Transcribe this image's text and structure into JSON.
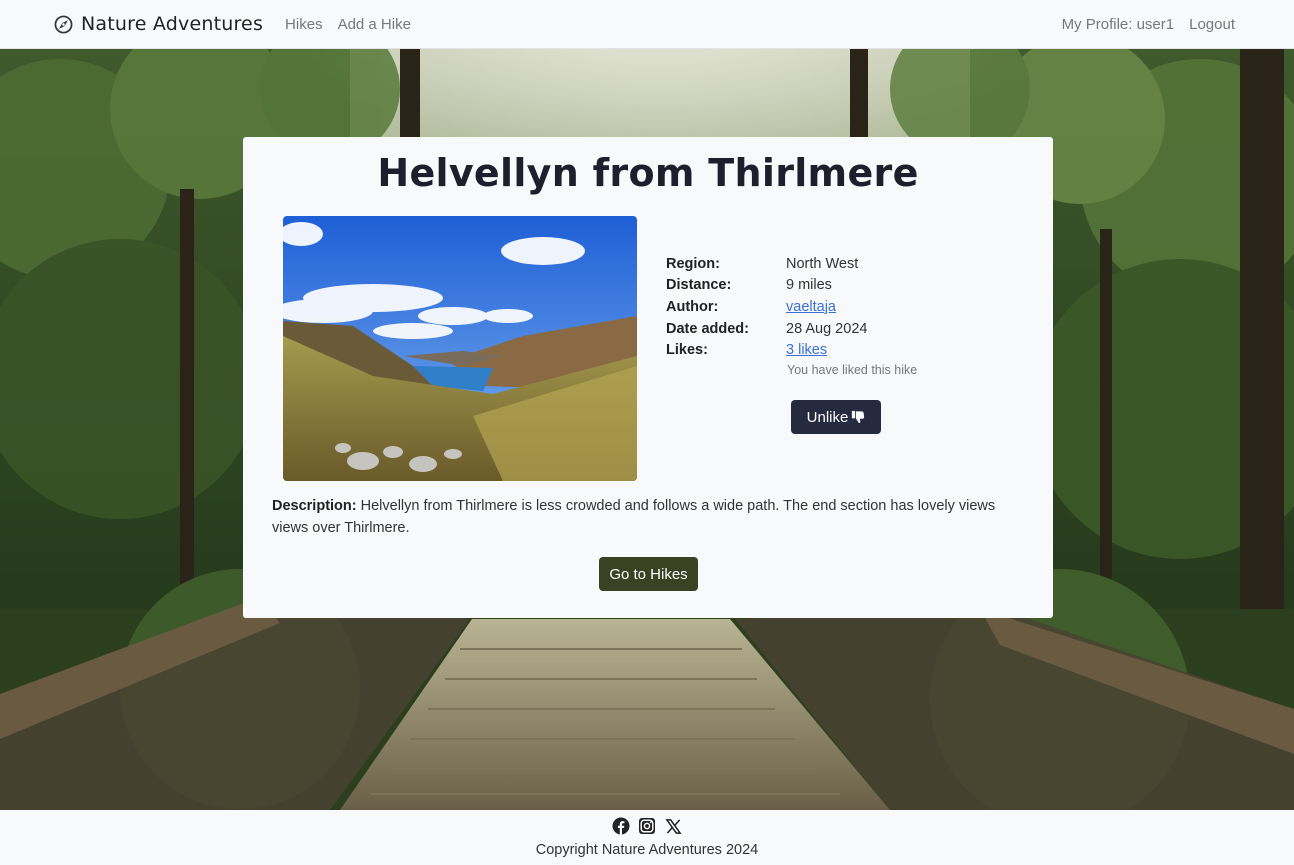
{
  "nav": {
    "brand": "Nature Adventures",
    "links": [
      "Hikes",
      "Add a Hike"
    ],
    "profile": "My Profile: user1",
    "logout": "Logout"
  },
  "hike": {
    "title": "Helvellyn from Thirlmere",
    "details": {
      "region_label": "Region:",
      "region": "North West",
      "distance_label": "Distance:",
      "distance": "9 miles",
      "author_label": "Author:",
      "author": "vaeltaja",
      "date_label": "Date added:",
      "date": "28 Aug 2024",
      "likes_label": "Likes:",
      "likes": "3 likes"
    },
    "liked_note": "You have liked this hike",
    "unlike_label": "Unlike",
    "description_label": "Description:",
    "description": "Helvellyn from Thirlmere is less crowded and follows a wide path. The end section has lovely views views over Thirlmere.",
    "go_button": "Go to Hikes"
  },
  "footer": {
    "copyright": "Copyright Nature Adventures 2024",
    "icons": [
      "facebook-icon",
      "instagram-icon",
      "x-icon"
    ]
  },
  "colors": {
    "unlike_button": "#262a3e",
    "go_button": "#3b4223",
    "link": "#3a6fd8"
  }
}
